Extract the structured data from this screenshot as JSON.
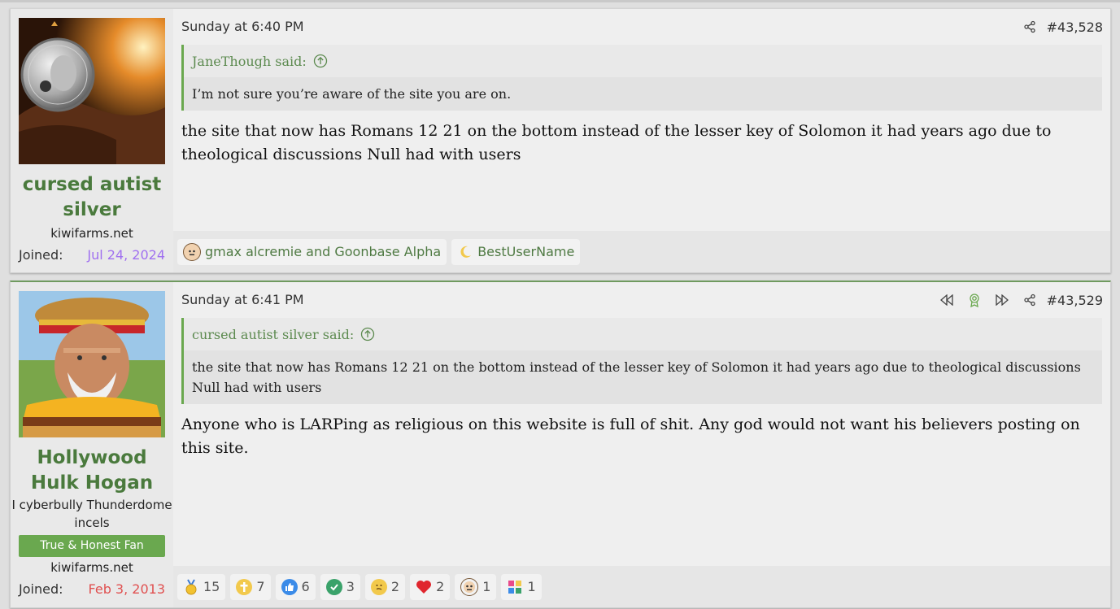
{
  "posts": [
    {
      "user": {
        "name": "cursed autist silver",
        "title": "",
        "site": "kiwifarms.net",
        "joined_label": "Joined:",
        "joined_date": "Jul 24, 2024"
      },
      "date": "Sunday at 6:40 PM",
      "post_number": "#43,528",
      "quote": {
        "author": "JaneThough said:",
        "text": "I’m not sure you’re aware of the site you are on."
      },
      "message": "the site that now has Romans 12 21 on the bottom instead of the lesser key of Solomon it had years ago due to theological discussions Null had with users",
      "reactions": [
        {
          "icon": "bald-face-emoji-icon",
          "label": "gmax alcremie and Goonbase Alpha"
        },
        {
          "icon": "moon-emoji-icon",
          "label": "BestUserName"
        }
      ]
    },
    {
      "user": {
        "name": "Hollywood Hulk Hogan",
        "title": "I cyberbully Thunderdome incels",
        "banner": "True & Honest Fan",
        "site": "kiwifarms.net",
        "joined_label": "Joined:",
        "joined_date": "Feb 3, 2013"
      },
      "date": "Sunday at 6:41 PM",
      "post_number": "#43,529",
      "quote": {
        "author": "cursed autist silver said:",
        "text": "the site that now has Romans 12 21 on the bottom instead of the lesser key of Solomon it had years ago due to theological discussions Null had with users"
      },
      "message": "Anyone who is LARPing as religious on this website is full of shit. Any god would not want his believers posting on this site.",
      "reactions": [
        {
          "icon": "medal-icon",
          "count": "15"
        },
        {
          "icon": "cross-icon",
          "count": "7"
        },
        {
          "icon": "thumbs-up-icon",
          "count": "6"
        },
        {
          "icon": "checkmark-icon",
          "count": "3"
        },
        {
          "icon": "thinking-face-icon",
          "count": "2"
        },
        {
          "icon": "heart-icon",
          "count": "2"
        },
        {
          "icon": "bald-face-emoji-icon",
          "count": "1"
        },
        {
          "icon": "puzzle-icon",
          "count": "1"
        }
      ]
    }
  ],
  "colors": {
    "accent_green": "#4a7a3d",
    "quote_bar": "#6aa84f",
    "joined_purple": "#a070f0",
    "joined_red": "#e05050"
  }
}
